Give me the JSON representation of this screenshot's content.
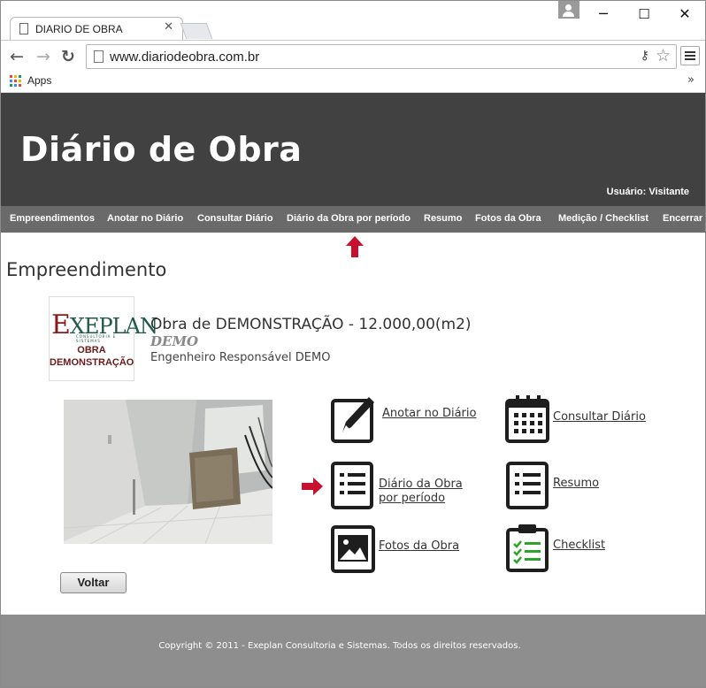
{
  "browser": {
    "tab_title": "DIARIO DE OBRA",
    "tab_close": "✕",
    "url": "www.diariodeobra.com.br",
    "back_icon": "←",
    "forward_icon": "→",
    "reload_icon": "↻",
    "minimize_icon": "─",
    "maximize_icon": "☐",
    "close_icon": "✕",
    "key_icon": "⚷",
    "star_icon": "☆",
    "bookmarks_label": "Apps",
    "bookmarks_more": "»"
  },
  "site": {
    "title": "Diário de Obra",
    "user_line": "Usuário: Visitante"
  },
  "nav": {
    "items": [
      {
        "label": "Empreendimentos"
      },
      {
        "label": "Anotar no Diário"
      },
      {
        "label": "Consultar Diário"
      },
      {
        "label": "Diário da Obra por período"
      },
      {
        "label": "Resumo"
      },
      {
        "label": "Fotos da Obra"
      },
      {
        "label": "Medição / Checklist"
      },
      {
        "label": "Encerrar"
      }
    ]
  },
  "main": {
    "section_title": "Empreendimento",
    "logo": {
      "brand_first": "E",
      "brand_rest": "XEPLAN",
      "tagline": "CONSULTORIA E SISTEMAS",
      "line1": "OBRA",
      "line2": "DEMONSTRAÇÃO"
    },
    "obra_title": "Obra de DEMONSTRAÇÃO - 12.000,00(m2)",
    "obra_subtitle": "DEMO",
    "engineer": "Engenheiro Responsável DEMO",
    "menu": {
      "anotar": "Anotar no Diário",
      "consultar": "Consultar Diário",
      "periodo_line1": "Diário da Obra",
      "periodo_line2": "por período",
      "resumo": "Resumo",
      "fotos": "Fotos da Obra",
      "checklist": "Checklist"
    },
    "back_button": "Voltar"
  },
  "footer": {
    "copyright": "Copyright © 2011 - Exeplan Consultoria e Sistemas. Todos os direitos reservados."
  },
  "colors": {
    "header_bg": "#414142",
    "nav_bg": "#6a6a6a",
    "footer_bg": "#8e8e8e",
    "arrow_red": "#c8102e",
    "checklist_green": "#2aa52a"
  }
}
